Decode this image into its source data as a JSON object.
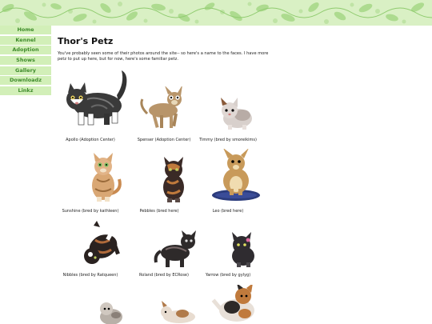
{
  "nav": {
    "items": [
      {
        "label": "Home"
      },
      {
        "label": "Kennel"
      },
      {
        "label": "Adoption"
      },
      {
        "label": "Shows"
      },
      {
        "label": "Gallery"
      },
      {
        "label": "Downloadz"
      },
      {
        "label": "Linkz"
      }
    ]
  },
  "page": {
    "title": "Thor's Petz",
    "intro": "You've probably seen some of their photos around the site-- so here's a name to the faces. I have more petz to put up here, but for now, here's some familiar petz."
  },
  "pets": [
    {
      "caption": "Apollo (Adoption Center)",
      "colors": {
        "main": "#3a3a3a",
        "accent": "#ffffff"
      }
    },
    {
      "caption": "Spenser (Adoption Center)",
      "colors": {
        "main": "#b8956a",
        "accent": "#e8d8b8"
      }
    },
    {
      "caption": "Timmy (bred by smoreikims)",
      "colors": {
        "main": "#d8d0cc",
        "accent": "#8a5a3a"
      }
    },
    {
      "caption": "Sunshine (bred by kathleen)",
      "colors": {
        "main": "#d9a774",
        "accent": "#f3e2c8"
      }
    },
    {
      "caption": "Pebbles (bred here)",
      "colors": {
        "main": "#3a2a26",
        "accent": "#c07a3c"
      }
    },
    {
      "caption": "Leo (bred here)",
      "colors": {
        "main": "#c89a5a",
        "accent": "#2c3c7c"
      }
    },
    {
      "caption": "Nibbles (bred by Ratqueen)",
      "colors": {
        "main": "#2a2220",
        "accent": "#b06a3a"
      }
    },
    {
      "caption": "Roland (bred by ECRose)",
      "colors": {
        "main": "#2e2a2a",
        "accent": "#7a6a6a"
      }
    },
    {
      "caption": "Yarrow (bred by gylyg)",
      "colors": {
        "main": "#2f2c30",
        "accent": "#e06aa0"
      }
    }
  ],
  "colors": {
    "banner": "#d9f0c4",
    "nav_bg": "#d2efb8",
    "nav_text": "#3f8b2c"
  }
}
